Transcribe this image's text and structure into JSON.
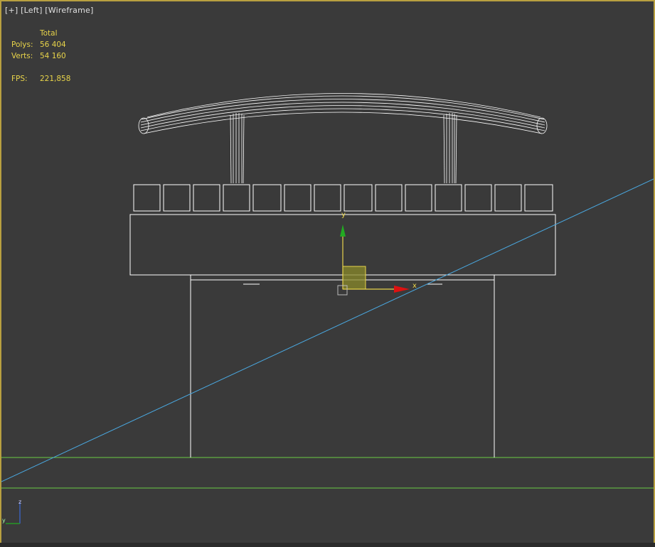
{
  "viewport": {
    "label_plus": "[+]",
    "label_view": "[Left]",
    "label_shading": "[Wireframe]",
    "border_color": "#b8a040"
  },
  "stats": {
    "header": "Total",
    "polys_label": "Polys:",
    "polys_value": "56 404",
    "verts_label": "Verts:",
    "verts_value": "54 160",
    "fps_label": "FPS:",
    "fps_value": "221,858",
    "color": "#e8d44a"
  },
  "gizmo": {
    "y_label": "y",
    "x_label": "x",
    "y_color": "#22aa22",
    "x_color": "#dd1111"
  },
  "axis_tripod": {
    "z_label": "z",
    "y_label": "y"
  },
  "colors": {
    "wire": "#ffffff",
    "cam_line": "#4aa8e0",
    "ground_line": "#6acc44",
    "background": "#3a3a3a"
  }
}
